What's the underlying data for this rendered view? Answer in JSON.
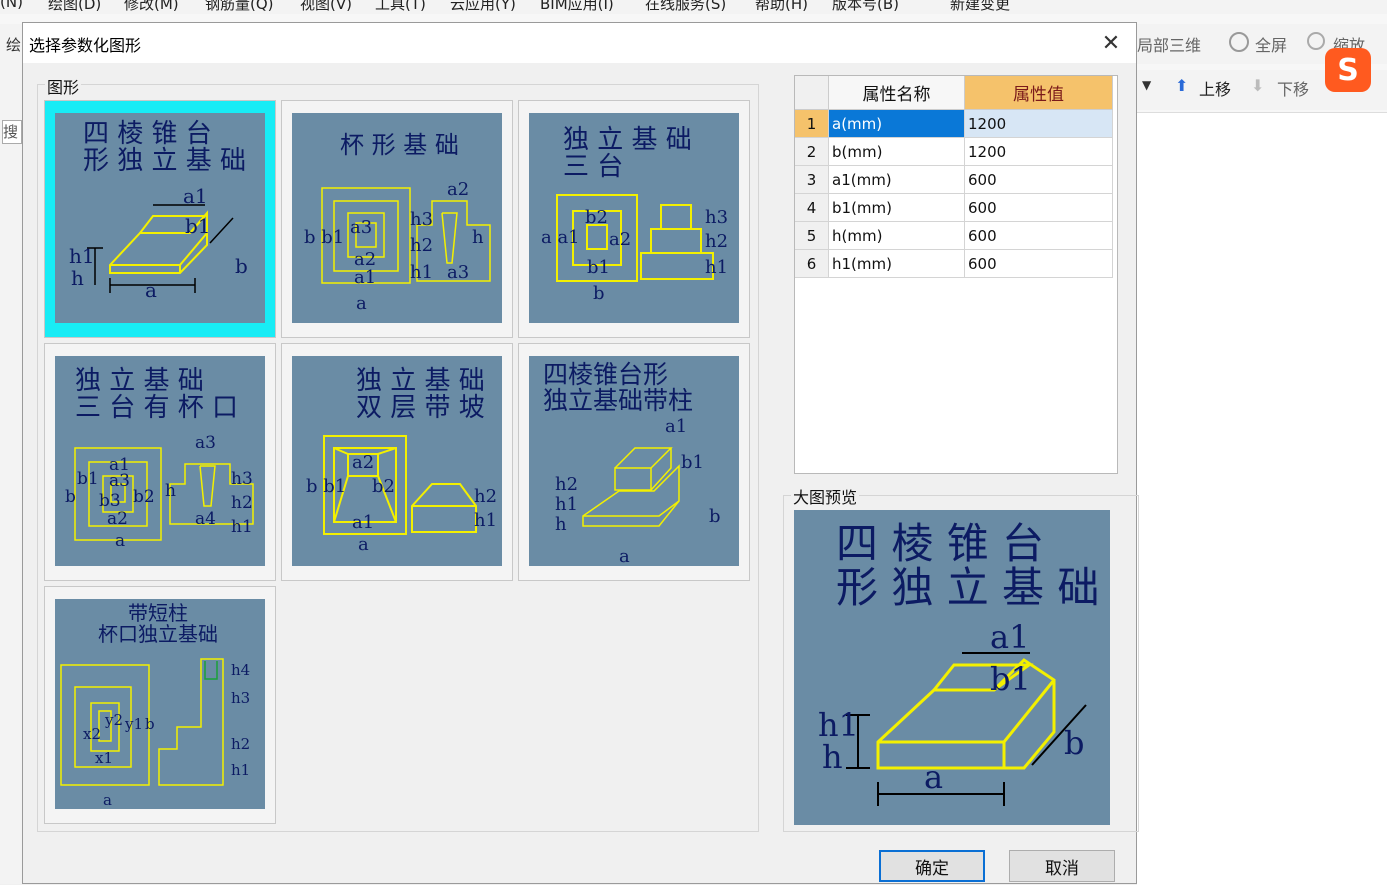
{
  "menu": [
    "(N)",
    "绘图(D)",
    "修改(M)",
    "钢筋量(Q)",
    "视图(V)",
    "工具(T)",
    "云应用(Y)",
    "BIM应用(I)",
    "在线服务(S)",
    "帮助(H)",
    "版本号(B)",
    "新建变更"
  ],
  "toolbar": {
    "local3d": "局部三维",
    "fullscreen": "全屏",
    "zoom": "缩放",
    "moveup": "上移",
    "movedown": "下移"
  },
  "side": {
    "draw": "绘",
    "search": "搜"
  },
  "dialog": {
    "title": "选择参数化图形",
    "shapes_group": "图形",
    "preview_group": "大图预览",
    "ok": "确定",
    "cancel": "取消"
  },
  "shapes": [
    {
      "title": "四 棱 锥 台\n形 独 立 基 础"
    },
    {
      "title": "杯 形 基 础"
    },
    {
      "title": "独 立 基 础\n三 台"
    },
    {
      "title": "独 立 基 础\n三 台 有 杯 口"
    },
    {
      "title": "独 立 基 础\n双 层 带 坡"
    },
    {
      "title": "四棱锥台形\n独立基础带柱"
    },
    {
      "title": "带短柱\n杯口独立基础"
    }
  ],
  "props": {
    "col_name": "属性名称",
    "col_value": "属性值",
    "rows": [
      {
        "no": "1",
        "name": "a(mm)",
        "value": "1200"
      },
      {
        "no": "2",
        "name": "b(mm)",
        "value": "1200"
      },
      {
        "no": "3",
        "name": "a1(mm)",
        "value": "600"
      },
      {
        "no": "4",
        "name": "b1(mm)",
        "value": "600"
      },
      {
        "no": "5",
        "name": "h(mm)",
        "value": "600"
      },
      {
        "no": "6",
        "name": "h1(mm)",
        "value": "600"
      }
    ]
  },
  "preview": {
    "title": "四 棱 锥 台\n形 独 立 基 础"
  },
  "colors": {
    "thumb_bg": "#6a8ca5",
    "shape": "#f3f000",
    "title": "#0c1b63",
    "selected": "#18ecf5",
    "table_header": "#f5c26b"
  }
}
